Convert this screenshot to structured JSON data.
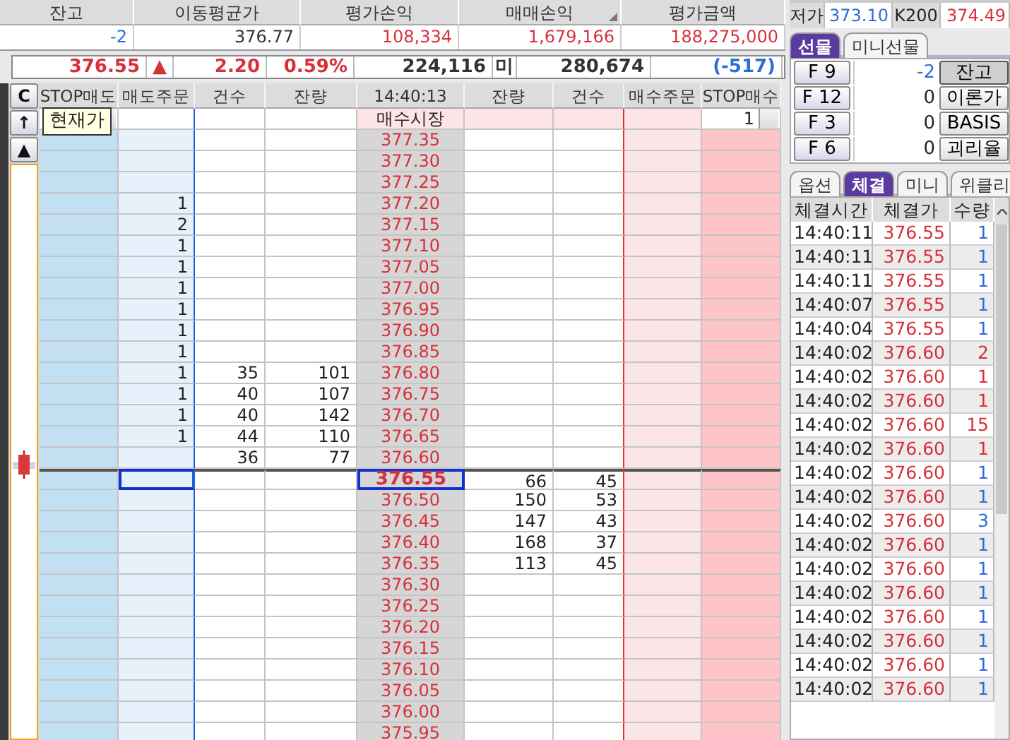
{
  "summary": {
    "columns": [
      {
        "label": "잔고"
      },
      {
        "label": "이동평균가"
      },
      {
        "label": "평가손익"
      },
      {
        "label": "매매손익",
        "sort_mark": true
      },
      {
        "label": "평가금액"
      }
    ],
    "values": [
      {
        "text": "-2",
        "color": "#2a6fd6"
      },
      {
        "text": "376.77",
        "color": "#333333"
      },
      {
        "text": "108,334",
        "color": "#d8303a"
      },
      {
        "text": "1,679,166",
        "color": "#d8303a"
      },
      {
        "text": "188,275,000",
        "color": "#d8303a"
      }
    ]
  },
  "quote": {
    "price": "376.55",
    "arrow": "▲",
    "change": "2.20",
    "rate": "0.59%",
    "volume": "224,116",
    "oi_label": "미",
    "open_interest": "280,674",
    "oi_change": "(-517)"
  },
  "side_buttons": [
    "C",
    "↑",
    "▲"
  ],
  "tooltip": "현재가",
  "order_book": {
    "columns": [
      "STOP매도",
      "매도주문",
      "건수",
      "잔량",
      "14:40:13",
      "잔량",
      "건수",
      "매수주문",
      "STOP매수"
    ],
    "rows": [
      {
        "kind": "market",
        "label": "매수시장",
        "stop_buy": "1",
        "current": false
      },
      {
        "kind": "price",
        "price": "377.35",
        "current": false
      },
      {
        "kind": "price",
        "price": "377.30",
        "current": false
      },
      {
        "kind": "price",
        "price": "377.25",
        "current": false
      },
      {
        "kind": "price",
        "price": "377.20",
        "sell_order": "1",
        "current": false
      },
      {
        "kind": "price",
        "price": "377.15",
        "sell_order": "2",
        "current": false
      },
      {
        "kind": "price",
        "price": "377.10",
        "sell_order": "1",
        "current": false
      },
      {
        "kind": "price",
        "price": "377.05",
        "sell_order": "1",
        "current": false
      },
      {
        "kind": "price",
        "price": "377.00",
        "sell_order": "1",
        "current": false
      },
      {
        "kind": "price",
        "price": "376.95",
        "sell_order": "1",
        "current": false
      },
      {
        "kind": "price",
        "price": "376.90",
        "sell_order": "1",
        "current": false
      },
      {
        "kind": "price",
        "price": "376.85",
        "sell_order": "1",
        "current": false
      },
      {
        "kind": "price",
        "price": "376.80",
        "sell_order": "1",
        "sell_count": "35",
        "sell_qty": "101",
        "current": false
      },
      {
        "kind": "price",
        "price": "376.75",
        "sell_order": "1",
        "sell_count": "40",
        "sell_qty": "107",
        "current": false
      },
      {
        "kind": "price",
        "price": "376.70",
        "sell_order": "1",
        "sell_count": "40",
        "sell_qty": "142",
        "current": false
      },
      {
        "kind": "price",
        "price": "376.65",
        "sell_order": "1",
        "sell_count": "44",
        "sell_qty": "110",
        "current": false
      },
      {
        "kind": "price",
        "price": "376.60",
        "sell_count": "36",
        "sell_qty": "77",
        "current": false
      },
      {
        "kind": "price",
        "price": "376.55",
        "buy_qty": "66",
        "buy_count": "45",
        "current": true
      },
      {
        "kind": "price",
        "price": "376.50",
        "buy_qty": "150",
        "buy_count": "53",
        "current": false
      },
      {
        "kind": "price",
        "price": "376.45",
        "buy_qty": "147",
        "buy_count": "43",
        "current": false
      },
      {
        "kind": "price",
        "price": "376.40",
        "buy_qty": "168",
        "buy_count": "37",
        "current": false
      },
      {
        "kind": "price",
        "price": "376.35",
        "buy_qty": "113",
        "buy_count": "45",
        "current": false
      },
      {
        "kind": "price",
        "price": "376.30",
        "current": false
      },
      {
        "kind": "price",
        "price": "376.25",
        "current": false
      },
      {
        "kind": "price",
        "price": "376.20",
        "current": false
      },
      {
        "kind": "price",
        "price": "376.15",
        "current": false
      },
      {
        "kind": "price",
        "price": "376.10",
        "current": false
      },
      {
        "kind": "price",
        "price": "376.05",
        "current": false
      },
      {
        "kind": "price",
        "price": "376.00",
        "current": false
      },
      {
        "kind": "price",
        "price": "375.95",
        "current": false
      }
    ]
  },
  "market_info": {
    "low_label": "저가",
    "low": "373.10",
    "index_label": "K200",
    "index": "374.49"
  },
  "futures_tabs": [
    {
      "label": "선물",
      "selected": true
    },
    {
      "label": "미니선물",
      "selected": false
    }
  ],
  "futures": [
    {
      "code": "F 9",
      "value": "-2",
      "color": "#2a6fd6",
      "action": "잔고",
      "selected": true
    },
    {
      "code": "F 12",
      "value": "0",
      "color": "#222222",
      "action": "이론가",
      "selected": false
    },
    {
      "code": "F 3",
      "value": "0",
      "color": "#222222",
      "action": "BASIS",
      "selected": false
    },
    {
      "code": "F 6",
      "value": "0",
      "color": "#222222",
      "action": "괴리율",
      "selected": false
    }
  ],
  "trade_tabs": [
    {
      "label": "옵션",
      "selected": false
    },
    {
      "label": "체결",
      "selected": true
    },
    {
      "label": "미니",
      "selected": false
    },
    {
      "label": "위클리",
      "selected": false
    }
  ],
  "trades": {
    "columns": [
      "체결시간",
      "체결가",
      "수량"
    ],
    "rows": [
      {
        "time": "14:40:11",
        "price": "376.55",
        "qty": "1",
        "color": "#2a6fd6"
      },
      {
        "time": "14:40:11",
        "price": "376.55",
        "qty": "1",
        "color": "#2a6fd6"
      },
      {
        "time": "14:40:11",
        "price": "376.55",
        "qty": "1",
        "color": "#2a6fd6"
      },
      {
        "time": "14:40:07",
        "price": "376.55",
        "qty": "1",
        "color": "#2a6fd6"
      },
      {
        "time": "14:40:04",
        "price": "376.55",
        "qty": "1",
        "color": "#2a6fd6"
      },
      {
        "time": "14:40:02",
        "price": "376.60",
        "qty": "2",
        "color": "#d8303a"
      },
      {
        "time": "14:40:02",
        "price": "376.60",
        "qty": "1",
        "color": "#d8303a"
      },
      {
        "time": "14:40:02",
        "price": "376.60",
        "qty": "1",
        "color": "#d8303a"
      },
      {
        "time": "14:40:02",
        "price": "376.60",
        "qty": "15",
        "color": "#d8303a"
      },
      {
        "time": "14:40:02",
        "price": "376.60",
        "qty": "1",
        "color": "#d8303a"
      },
      {
        "time": "14:40:02",
        "price": "376.60",
        "qty": "1",
        "color": "#2a6fd6"
      },
      {
        "time": "14:40:02",
        "price": "376.60",
        "qty": "1",
        "color": "#2a6fd6"
      },
      {
        "time": "14:40:02",
        "price": "376.60",
        "qty": "3",
        "color": "#2a6fd6"
      },
      {
        "time": "14:40:02",
        "price": "376.60",
        "qty": "1",
        "color": "#2a6fd6"
      },
      {
        "time": "14:40:02",
        "price": "376.60",
        "qty": "1",
        "color": "#2a6fd6"
      },
      {
        "time": "14:40:02",
        "price": "376.60",
        "qty": "1",
        "color": "#2a6fd6"
      },
      {
        "time": "14:40:02",
        "price": "376.60",
        "qty": "1",
        "color": "#2a6fd6"
      },
      {
        "time": "14:40:02",
        "price": "376.60",
        "qty": "1",
        "color": "#2a6fd6"
      },
      {
        "time": "14:40:02",
        "price": "376.60",
        "qty": "1",
        "color": "#2a6fd6"
      },
      {
        "time": "14:40:02",
        "price": "376.60",
        "qty": "1",
        "color": "#2a6fd6"
      }
    ]
  }
}
